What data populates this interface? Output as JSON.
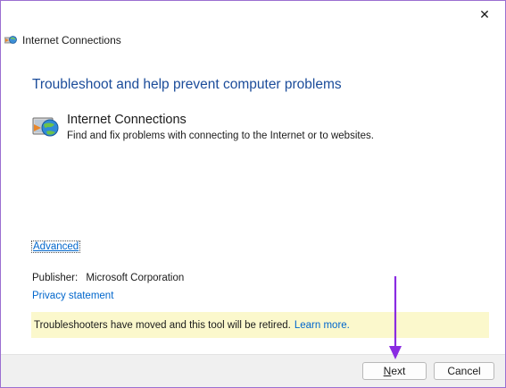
{
  "window": {
    "title": "Internet Connections",
    "close_symbol": "✕"
  },
  "main": {
    "heading": "Troubleshoot and help prevent computer problems",
    "tool": {
      "name": "Internet Connections",
      "description": "Find and fix problems with connecting to the Internet or to websites.",
      "icon": "internet-connections-icon"
    },
    "advanced_link": "Advanced",
    "publisher_label": "Publisher:",
    "publisher_value": "Microsoft Corporation",
    "privacy_link": "Privacy statement"
  },
  "notice": {
    "text": "Troubleshooters have moved and this tool will be retired.",
    "link": "Learn more."
  },
  "footer": {
    "next_label": "Next",
    "next_mnemonic": "N",
    "next_rest": "ext",
    "cancel_label": "Cancel"
  },
  "colors": {
    "heading": "#1b4c9a",
    "link": "#0066cc",
    "notice_bg": "#fbf8cc",
    "annotation_arrow": "#8a2be2",
    "window_border": "#9b6fd1"
  }
}
